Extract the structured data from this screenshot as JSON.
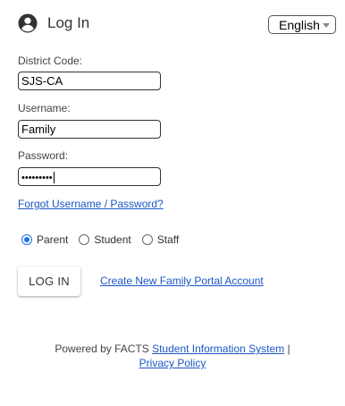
{
  "header": {
    "title": "Log In",
    "language_select": {
      "value": "English"
    }
  },
  "form": {
    "district_code": {
      "label": "District Code:",
      "value": "SJS-CA"
    },
    "username": {
      "label": "Username:",
      "value": "Family"
    },
    "password": {
      "label": "Password:",
      "value": "•••••••••"
    },
    "forgot_link": "Forgot Username / Password?"
  },
  "roles": [
    {
      "label": "Parent",
      "checked": true
    },
    {
      "label": "Student",
      "checked": false
    },
    {
      "label": "Staff",
      "checked": false
    }
  ],
  "actions": {
    "login_button": "LOG IN",
    "create_account_link": "Create New Family Portal Account"
  },
  "footer": {
    "powered_by": "Powered by FACTS ",
    "sis_link": "Student Information System",
    "separator": " |",
    "privacy_link": "Privacy Policy"
  },
  "colors": {
    "link": "#1a56c4",
    "radio_checked": "#1a73e8"
  }
}
